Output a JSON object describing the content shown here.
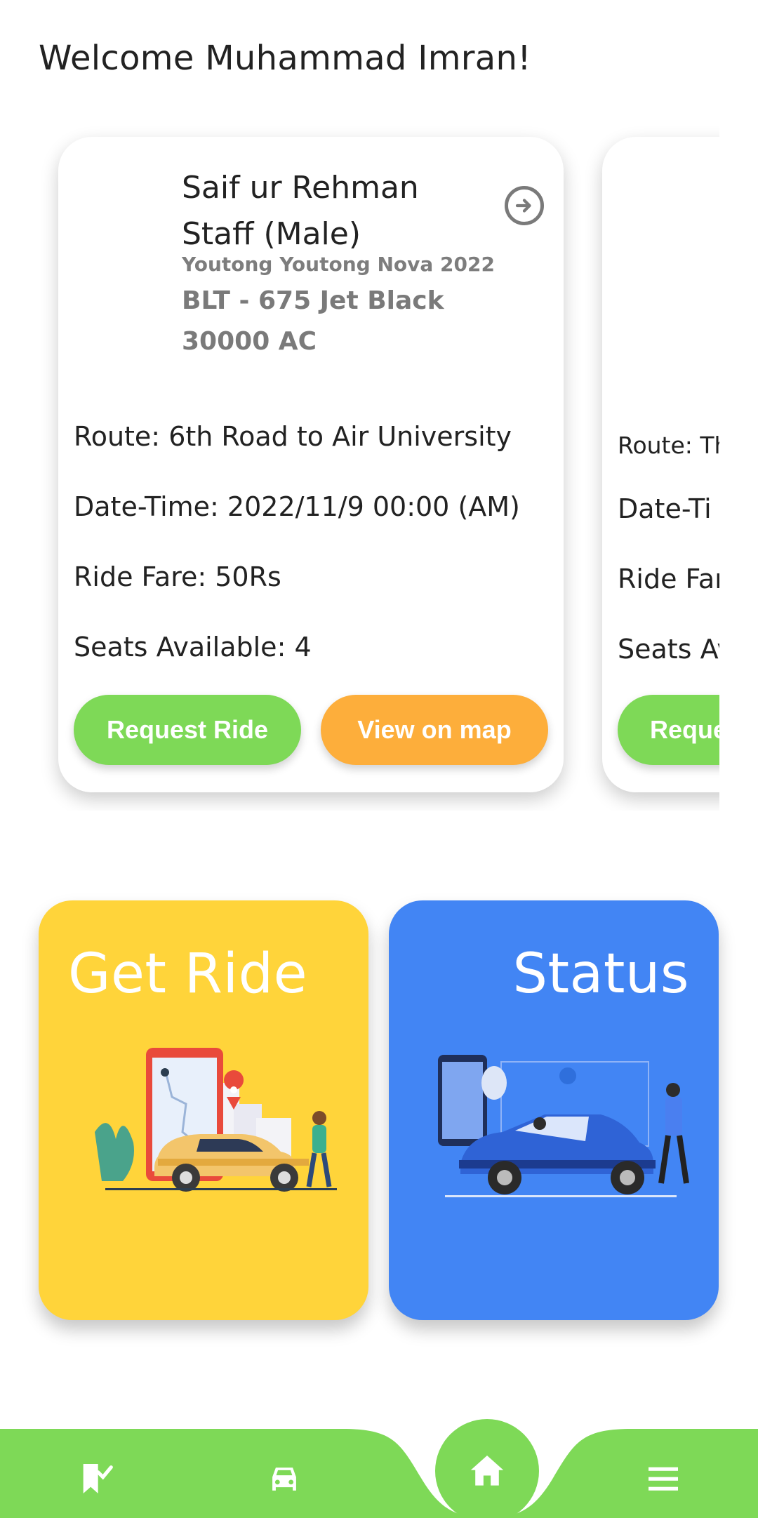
{
  "header": {
    "welcome": "Welcome Muhammad Imran!"
  },
  "rides": [
    {
      "driver_name": "Saif ur Rehman",
      "driver_role": "Staff (Male)",
      "vehicle_model": "Youtong Youtong Nova 2022",
      "vehicle_plate": "BLT - 675 Jet Black 30000 AC",
      "route": "Route: 6th Road to Air University",
      "datetime": "Date-Time: 2022/11/9 00:00 (AM)",
      "fare": "Ride Fare: 50Rs",
      "seats": "Seats Available: 4",
      "request_label": "Request Ride",
      "map_label": "View on map"
    },
    {
      "route": "Route: Th",
      "datetime": "Date-Ti",
      "fare": "Ride Far",
      "seats": "Seats Av",
      "request_label": "Reque"
    }
  ],
  "tiles": {
    "get_ride": "Get Ride",
    "status": "Status"
  },
  "colors": {
    "green": "#7ed957",
    "orange": "#fdae3b",
    "yellow": "#ffd43a",
    "blue": "#4285f4"
  },
  "nav": {
    "items": [
      "bookmark-check-icon",
      "car-icon",
      "home-icon",
      "menu-icon"
    ],
    "active": "home-icon"
  }
}
